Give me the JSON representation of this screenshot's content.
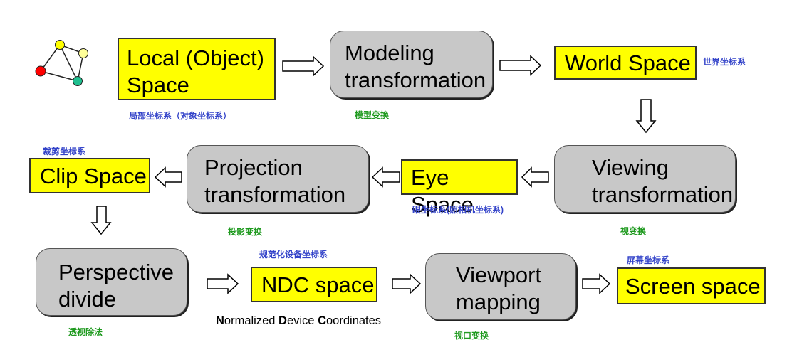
{
  "boxes": {
    "local": "Local (Object)\nSpace",
    "modeling": "Modeling\ntransformation",
    "world": "World Space",
    "viewing": "Viewing\ntransformation",
    "eye": "Eye Space",
    "projection": "Projection\ntransformation",
    "clip": "Clip Space",
    "perspective": "Perspective\ndivide",
    "ndc": "NDC space",
    "viewport": "Viewport\nmapping",
    "screen": "Screen space"
  },
  "labels": {
    "local_cn": "局部坐标系（对象坐标系）",
    "modeling_cn": "模型变换",
    "world_cn": "世界坐标系",
    "clip_cn": "裁剪坐标系",
    "eye_cn": "眼坐标系(照相机坐标系)",
    "projection_cn": "投影变换",
    "viewing_cn": "视变换",
    "ndc_cn": "规范化设备坐标系",
    "perspective_cn": "透视除法",
    "viewport_cn": "视口变换",
    "screen_cn": "屏幕坐标系"
  },
  "ndc_full": {
    "n": "N",
    "ormalized": "ormalized ",
    "d": "D",
    "evice": "evice ",
    "c": "C",
    "oordinates": "oordinates"
  },
  "colors": {
    "box_yellow": "#ffff00",
    "box_gray": "#c8c8c8",
    "label_blue": "#3343c9",
    "label_green": "#1f9a1f"
  }
}
